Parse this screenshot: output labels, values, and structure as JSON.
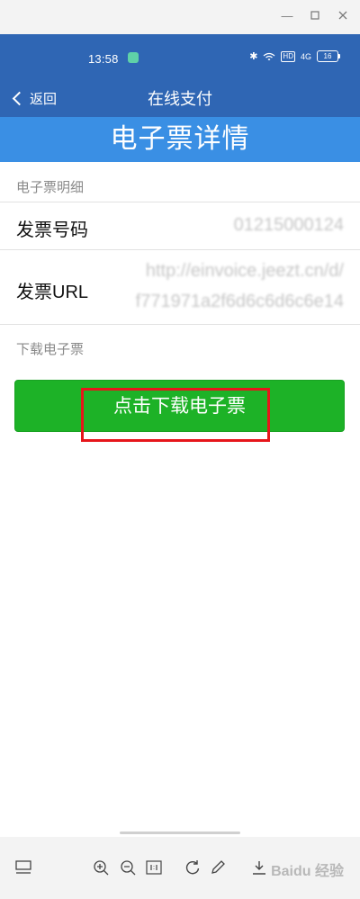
{
  "status": {
    "time": "13:58",
    "hd": "HD",
    "signal": "4G",
    "battery": "16"
  },
  "nav": {
    "back_label": "返回",
    "title": "在线支付"
  },
  "banner": {
    "title": "电子票详情"
  },
  "details": {
    "section_label": "电子票明细",
    "invoice_number_label": "发票号码",
    "invoice_number_value": "01215000124",
    "invoice_url_label": "发票URL",
    "invoice_url_line1": "http://einvoice.jeezt.cn/d/",
    "invoice_url_line2": "f771971a2f6d6c6d6c6e14"
  },
  "download": {
    "section_label": "下载电子票",
    "button_label": "点击下载电子票"
  },
  "watermark": "Baidu 经验",
  "colors": {
    "header_blue": "#2f66b4",
    "banner_blue": "#3a8fe4",
    "button_green": "#1db227",
    "highlight_red": "#e6161b"
  },
  "toolbar_icons": [
    "layout-icon",
    "zoom-in-icon",
    "zoom-out-icon",
    "actual-size-icon",
    "rotate-icon",
    "edit-icon",
    "download-icon"
  ]
}
